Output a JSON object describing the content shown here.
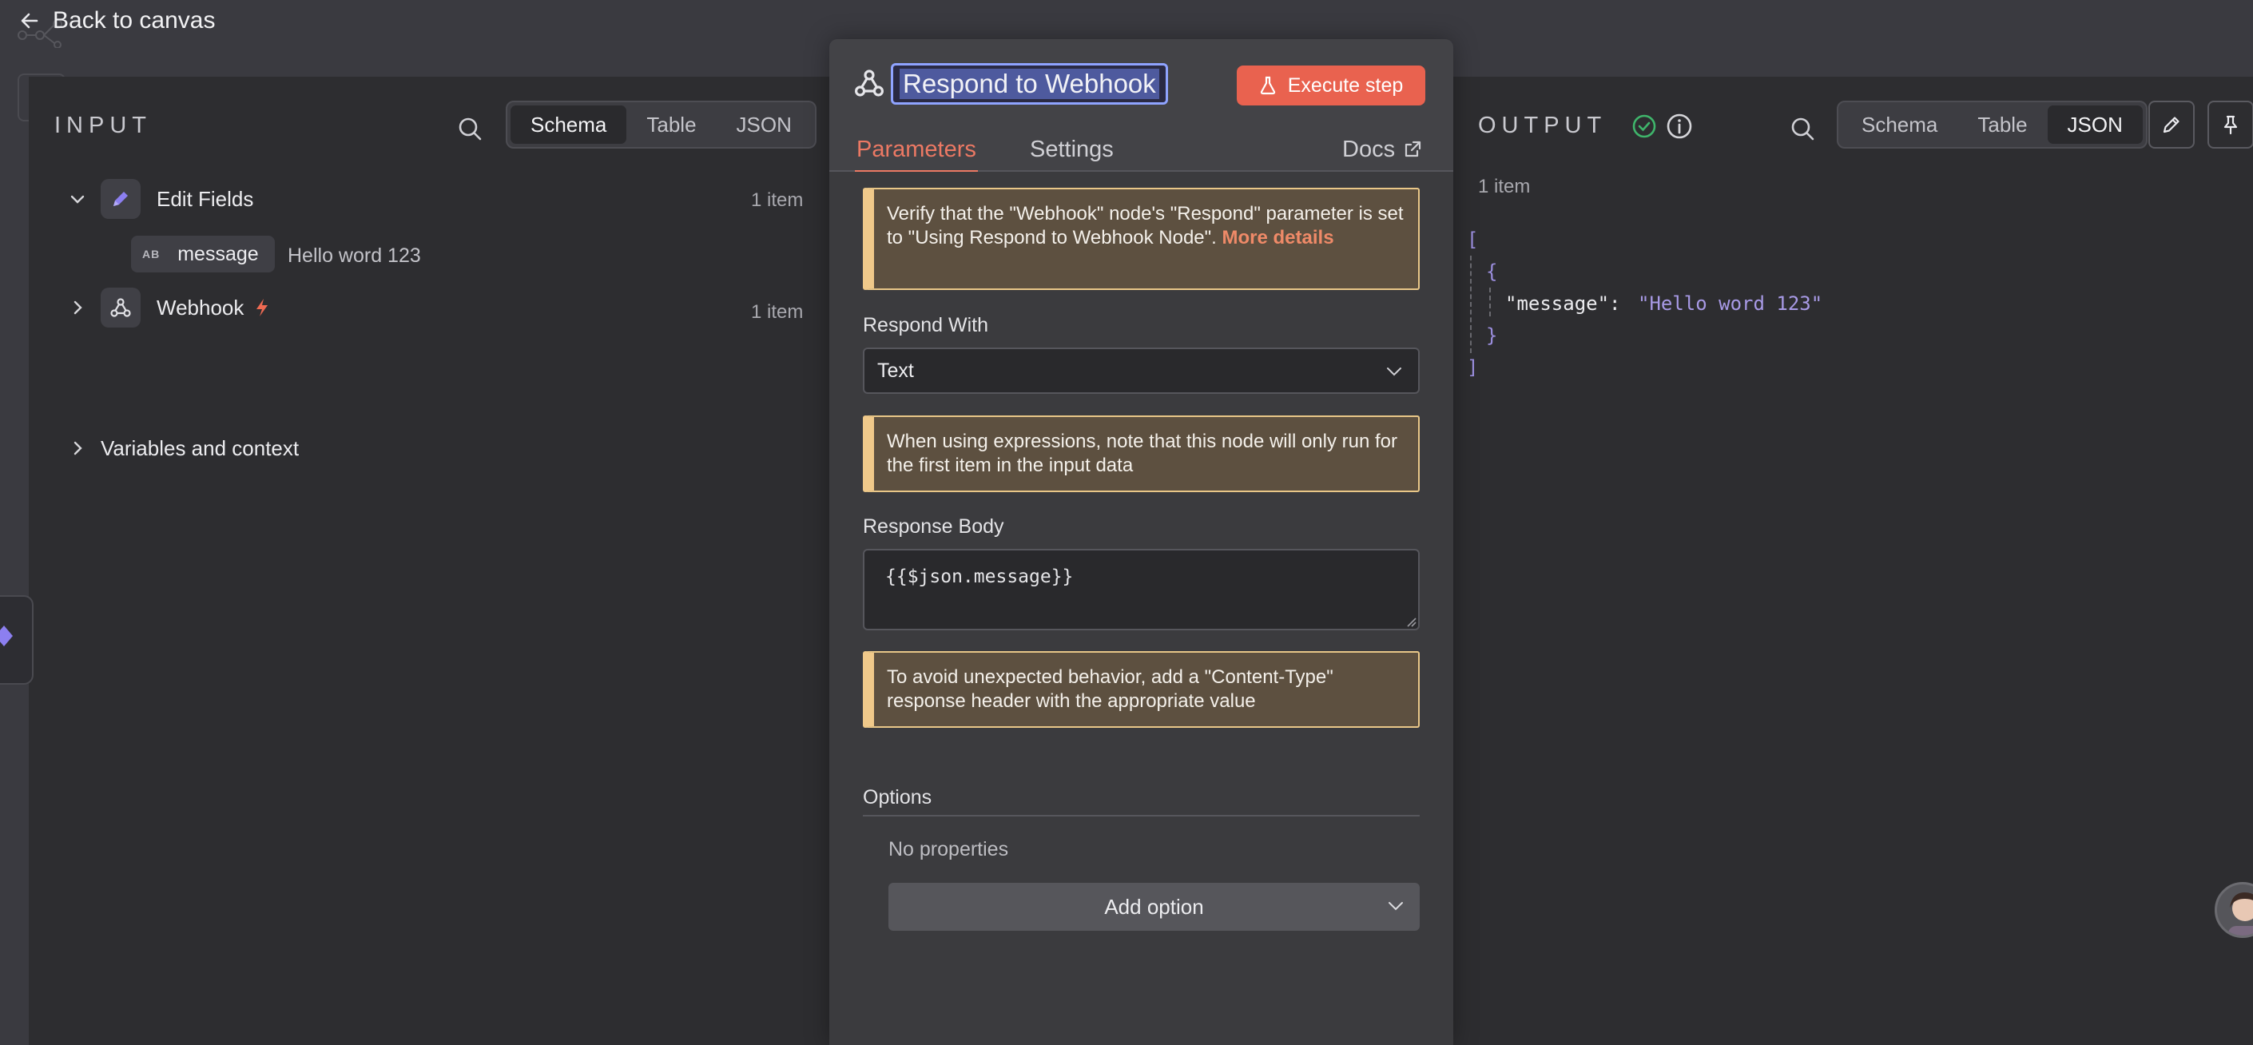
{
  "header": {
    "back_label": "Back to canvas"
  },
  "input_panel": {
    "title": "INPUT",
    "view_options": [
      "Schema",
      "Table",
      "JSON"
    ],
    "active_view": "Schema",
    "tree": {
      "edit_fields": {
        "label": "Edit Fields",
        "count": "1 item"
      },
      "field": {
        "type_badge": "AB",
        "name": "message",
        "value": "Hello word 123"
      },
      "webhook": {
        "label": "Webhook",
        "count": "1 item"
      },
      "variables": {
        "label": "Variables and context"
      }
    }
  },
  "node_panel": {
    "title": "Respond to Webhook",
    "execute_label": "Execute step",
    "tabs": {
      "parameters": "Parameters",
      "settings": "Settings",
      "docs": "Docs"
    },
    "notice_webhook": {
      "text": "Verify that the \"Webhook\" node's \"Respond\" parameter is set to \"Using Respond to Webhook Node\". ",
      "more": "More details"
    },
    "respond_with": {
      "label": "Respond With",
      "value": "Text"
    },
    "notice_expressions": "When using expressions, note that this node will only run for the first item in the input data",
    "response_body": {
      "label": "Response Body",
      "value": "{{$json.message}}"
    },
    "notice_content_type": "To avoid unexpected behavior, add a \"Content-Type\" response header with the appropriate value",
    "options": {
      "title": "Options",
      "empty": "No properties",
      "add_label": "Add option"
    }
  },
  "output_panel": {
    "title": "OUTPUT",
    "view_options": [
      "Schema",
      "Table",
      "JSON"
    ],
    "active_view": "JSON",
    "count": "1 item",
    "json": {
      "open_array": "[",
      "open_obj": "{",
      "key": "\"message\":",
      "value": "\"Hello word 123\"",
      "close_obj": "}",
      "close_array": "]"
    }
  },
  "colors": {
    "accent": "#ec7964",
    "execute": "#e9624f",
    "success": "#3fb56b",
    "json_string": "#a89ae6",
    "notice_bg": "#5d5040"
  }
}
